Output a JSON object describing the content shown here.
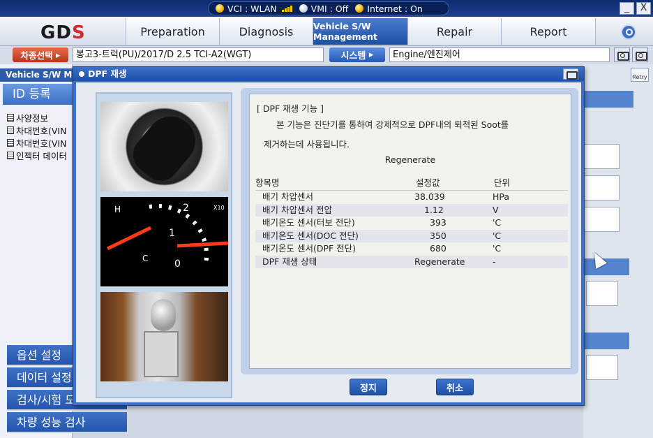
{
  "status": {
    "vci": "VCI : WLAN",
    "vmi": "VMI : Off",
    "internet": "Internet : On"
  },
  "window": {
    "minimize": "_",
    "close": "X"
  },
  "menu": {
    "logo": "GDS",
    "tabs": [
      "Preparation",
      "Diagnosis",
      "Vehicle S/W Management",
      "Repair",
      "Report"
    ],
    "active_tab": "Vehicle S/W Management"
  },
  "vehicle_bar": {
    "select_label": "차종선택",
    "vehicle": "봉고3-트럭(PU)/2017/D 2.5 TCI-A2(WGT)",
    "system_label": "시스템",
    "system": "Engine/엔진제어"
  },
  "left": {
    "title": "Vehicle S/W M",
    "id_button": "ID 등록",
    "items": [
      "사양정보",
      "차대번호(VIN",
      "차대번호(VIN",
      "인젝터 데이터"
    ],
    "buttons": [
      "옵션 설정",
      "데이터 설정",
      "검사/시험 모드",
      "차량 성능 검사"
    ]
  },
  "right": {
    "retry": "Retry"
  },
  "dialog": {
    "title": "DPF 재생",
    "section_title": "[ DPF 재생 기능 ]",
    "desc_line1": "본 기능은 진단기를 통하여 강제적으로 DPF내의 퇴적된 Soot를",
    "desc_line2": "제거하는데 사용됩니다.",
    "state_title": "Regenerate",
    "table": {
      "headers": [
        "항목명",
        "설정값",
        "단위"
      ],
      "rows": [
        {
          "name": "배기 차압센서",
          "value": "38.039",
          "unit": "HPa"
        },
        {
          "name": "배기 차압센서 전압",
          "value": "1.12",
          "unit": "V"
        },
        {
          "name": "배기온도 센서(터보 전단)",
          "value": "393",
          "unit": "'C"
        },
        {
          "name": "배기온도 센서(DOC 전단)",
          "value": "350",
          "unit": "'C"
        },
        {
          "name": "배기온도 센서(DPF 전단)",
          "value": "680",
          "unit": "'C"
        },
        {
          "name": "DPF 재생 상태",
          "value": "Regenerate",
          "unit": "-"
        }
      ]
    },
    "stop_button": "정지",
    "cancel_button": "취소"
  },
  "colors": {
    "accent": "#2356ac",
    "alert": "#c0391f",
    "led": "#f0b400"
  }
}
